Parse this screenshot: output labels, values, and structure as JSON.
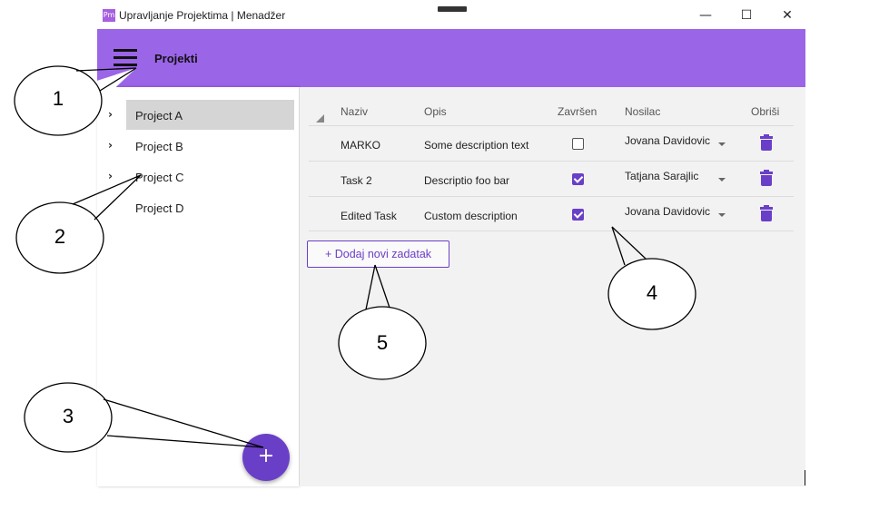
{
  "window": {
    "badge": "Pm",
    "title": "Upravljanje Projektima | Menadžer",
    "minimize_glyph": "—",
    "maximize_glyph": "☐",
    "close_glyph": "✕"
  },
  "appbar": {
    "title": "Projekti"
  },
  "sidebar": {
    "projects": [
      {
        "label": "Project A",
        "expandable": true,
        "selected": true
      },
      {
        "label": "Project B",
        "expandable": true,
        "selected": false
      },
      {
        "label": "Project C",
        "expandable": true,
        "selected": false
      },
      {
        "label": "Project D",
        "expandable": false,
        "selected": false
      }
    ],
    "chevron_glyph": "›",
    "fab_glyph": "+"
  },
  "table": {
    "headers": {
      "naziv": "Naziv",
      "opis": "Opis",
      "zavrsen": "Završen",
      "nosilac": "Nosilac",
      "obrisi": "Obriši"
    },
    "rows": [
      {
        "naziv": "MARKO",
        "opis": "Some description text",
        "zavrsen": false,
        "nosilac": "Jovana Davidovic"
      },
      {
        "naziv": "Task 2",
        "opis": "Descriptio foo bar",
        "zavrsen": true,
        "nosilac": "Tatjana Sarajlic"
      },
      {
        "naziv": "Edited Task",
        "opis": "Custom description",
        "zavrsen": true,
        "nosilac": "Jovana Davidovic"
      }
    ]
  },
  "add_task_button": "+ Dodaj novi zadatak",
  "callouts": [
    "1",
    "2",
    "3",
    "4",
    "5"
  ],
  "colors": {
    "appbar": "#9b65e8",
    "accent": "#6a3fc7",
    "selected_bg": "#d5d5d5"
  }
}
